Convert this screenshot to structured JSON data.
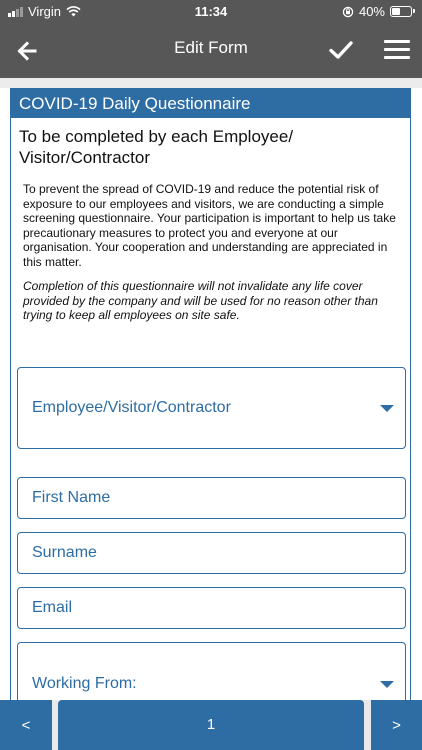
{
  "status_bar": {
    "carrier": "Virgin",
    "time": "11:34",
    "battery": "40%",
    "battery_level": 0.4
  },
  "header": {
    "title": "Edit Form"
  },
  "form": {
    "title": "COVID-19 Daily Questionnaire",
    "subtitle": "To be completed by each Employee/ Visitor/Contractor",
    "intro": "To prevent the spread of COVID-19 and reduce the potential risk of exposure to our employees and visitors, we are conducting a simple screening questionnaire. Your participation is important to help us take precautionary measures to protect you and everyone at our organisation. Your cooperation and understanding are appreciated in this matter.",
    "note": "Completion of this questionnaire will not invalidate any life cover provided by the company and will be used for no reason other than trying to keep all employees on site safe.",
    "fields": {
      "role_select": "Employee/Visitor/Contractor",
      "first_name": "First Name",
      "surname": "Surname",
      "email": "Email",
      "working_from": "Working From:"
    }
  },
  "pagination": {
    "prev": "<",
    "page": "1",
    "next": ">"
  }
}
